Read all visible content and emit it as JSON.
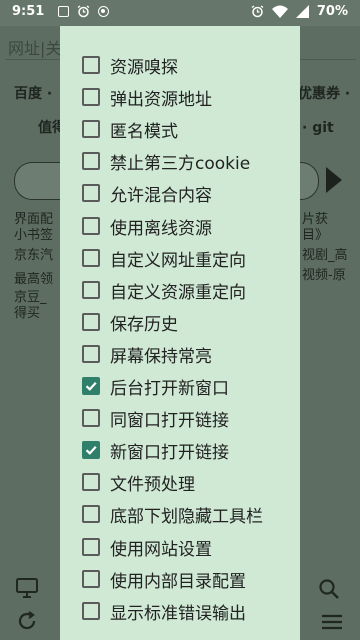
{
  "status_bar": {
    "time": "9:51",
    "battery": "70%"
  },
  "background": {
    "url_placeholder": "网址|关",
    "row1_left": "百度 ·",
    "row1_right": "优惠券 ·",
    "row2_left": "值得",
    "row2_right": "· git",
    "col_left": [
      "界面配",
      "小书签",
      "京东汽",
      "最高领",
      "京豆_",
      "得买"
    ],
    "col_right": [
      "片获",
      "目》",
      "视剧_高",
      "视频-原"
    ]
  },
  "menu": {
    "items": [
      {
        "label": "资源嗅探",
        "checked": false
      },
      {
        "label": "弹出资源地址",
        "checked": false
      },
      {
        "label": "匿名模式",
        "checked": false
      },
      {
        "label": "禁止第三方cookie",
        "checked": false
      },
      {
        "label": "允许混合内容",
        "checked": false
      },
      {
        "label": "使用离线资源",
        "checked": false
      },
      {
        "label": "自定义网址重定向",
        "checked": false
      },
      {
        "label": "自定义资源重定向",
        "checked": false
      },
      {
        "label": "保存历史",
        "checked": false
      },
      {
        "label": "屏幕保持常亮",
        "checked": false
      },
      {
        "label": "后台打开新窗口",
        "checked": true
      },
      {
        "label": "同窗口打开链接",
        "checked": false
      },
      {
        "label": "新窗口打开链接",
        "checked": true
      },
      {
        "label": "文件预处理",
        "checked": false
      },
      {
        "label": "底部下划隐藏工具栏",
        "checked": false
      },
      {
        "label": "使用网站设置",
        "checked": false
      },
      {
        "label": "使用内部目录配置",
        "checked": false
      },
      {
        "label": "显示标准错误输出",
        "checked": false
      }
    ]
  },
  "colors": {
    "checkbox_checked": "#2f7f6a",
    "menu_bg": "#cfe9d5"
  }
}
